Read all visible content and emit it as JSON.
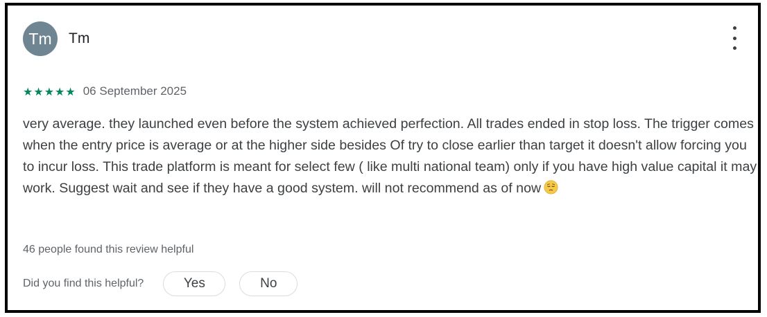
{
  "review": {
    "avatar_initials": "Tm",
    "author_name": "Tm",
    "more_options_icon": "more-vert-icon",
    "rating": 5,
    "rating_max": 5,
    "stars_text": "★★★★★",
    "date": "06 September 2025",
    "body_text": "very average. they launched even before the system achieved perfection. All trades ended in stop loss. The trigger comes when the entry price is average or at the higher side besides Of try to close earlier than target it doesn't allow forcing you to incur loss. This trade platform is meant for select few ( like multi national team) only if you have high value capital it may work. Suggest wait and see if they have a good system. will not recommend as of now",
    "body_emoji_icon": "pensive-face-emoji-icon",
    "helpful_count_text": "46 people found this review helpful",
    "feedback_question": "Did you find this helpful?",
    "yes_label": "Yes",
    "no_label": "No"
  },
  "colors": {
    "avatar_bg": "#6f8592",
    "star_color": "#01875f",
    "border": "#000000"
  }
}
